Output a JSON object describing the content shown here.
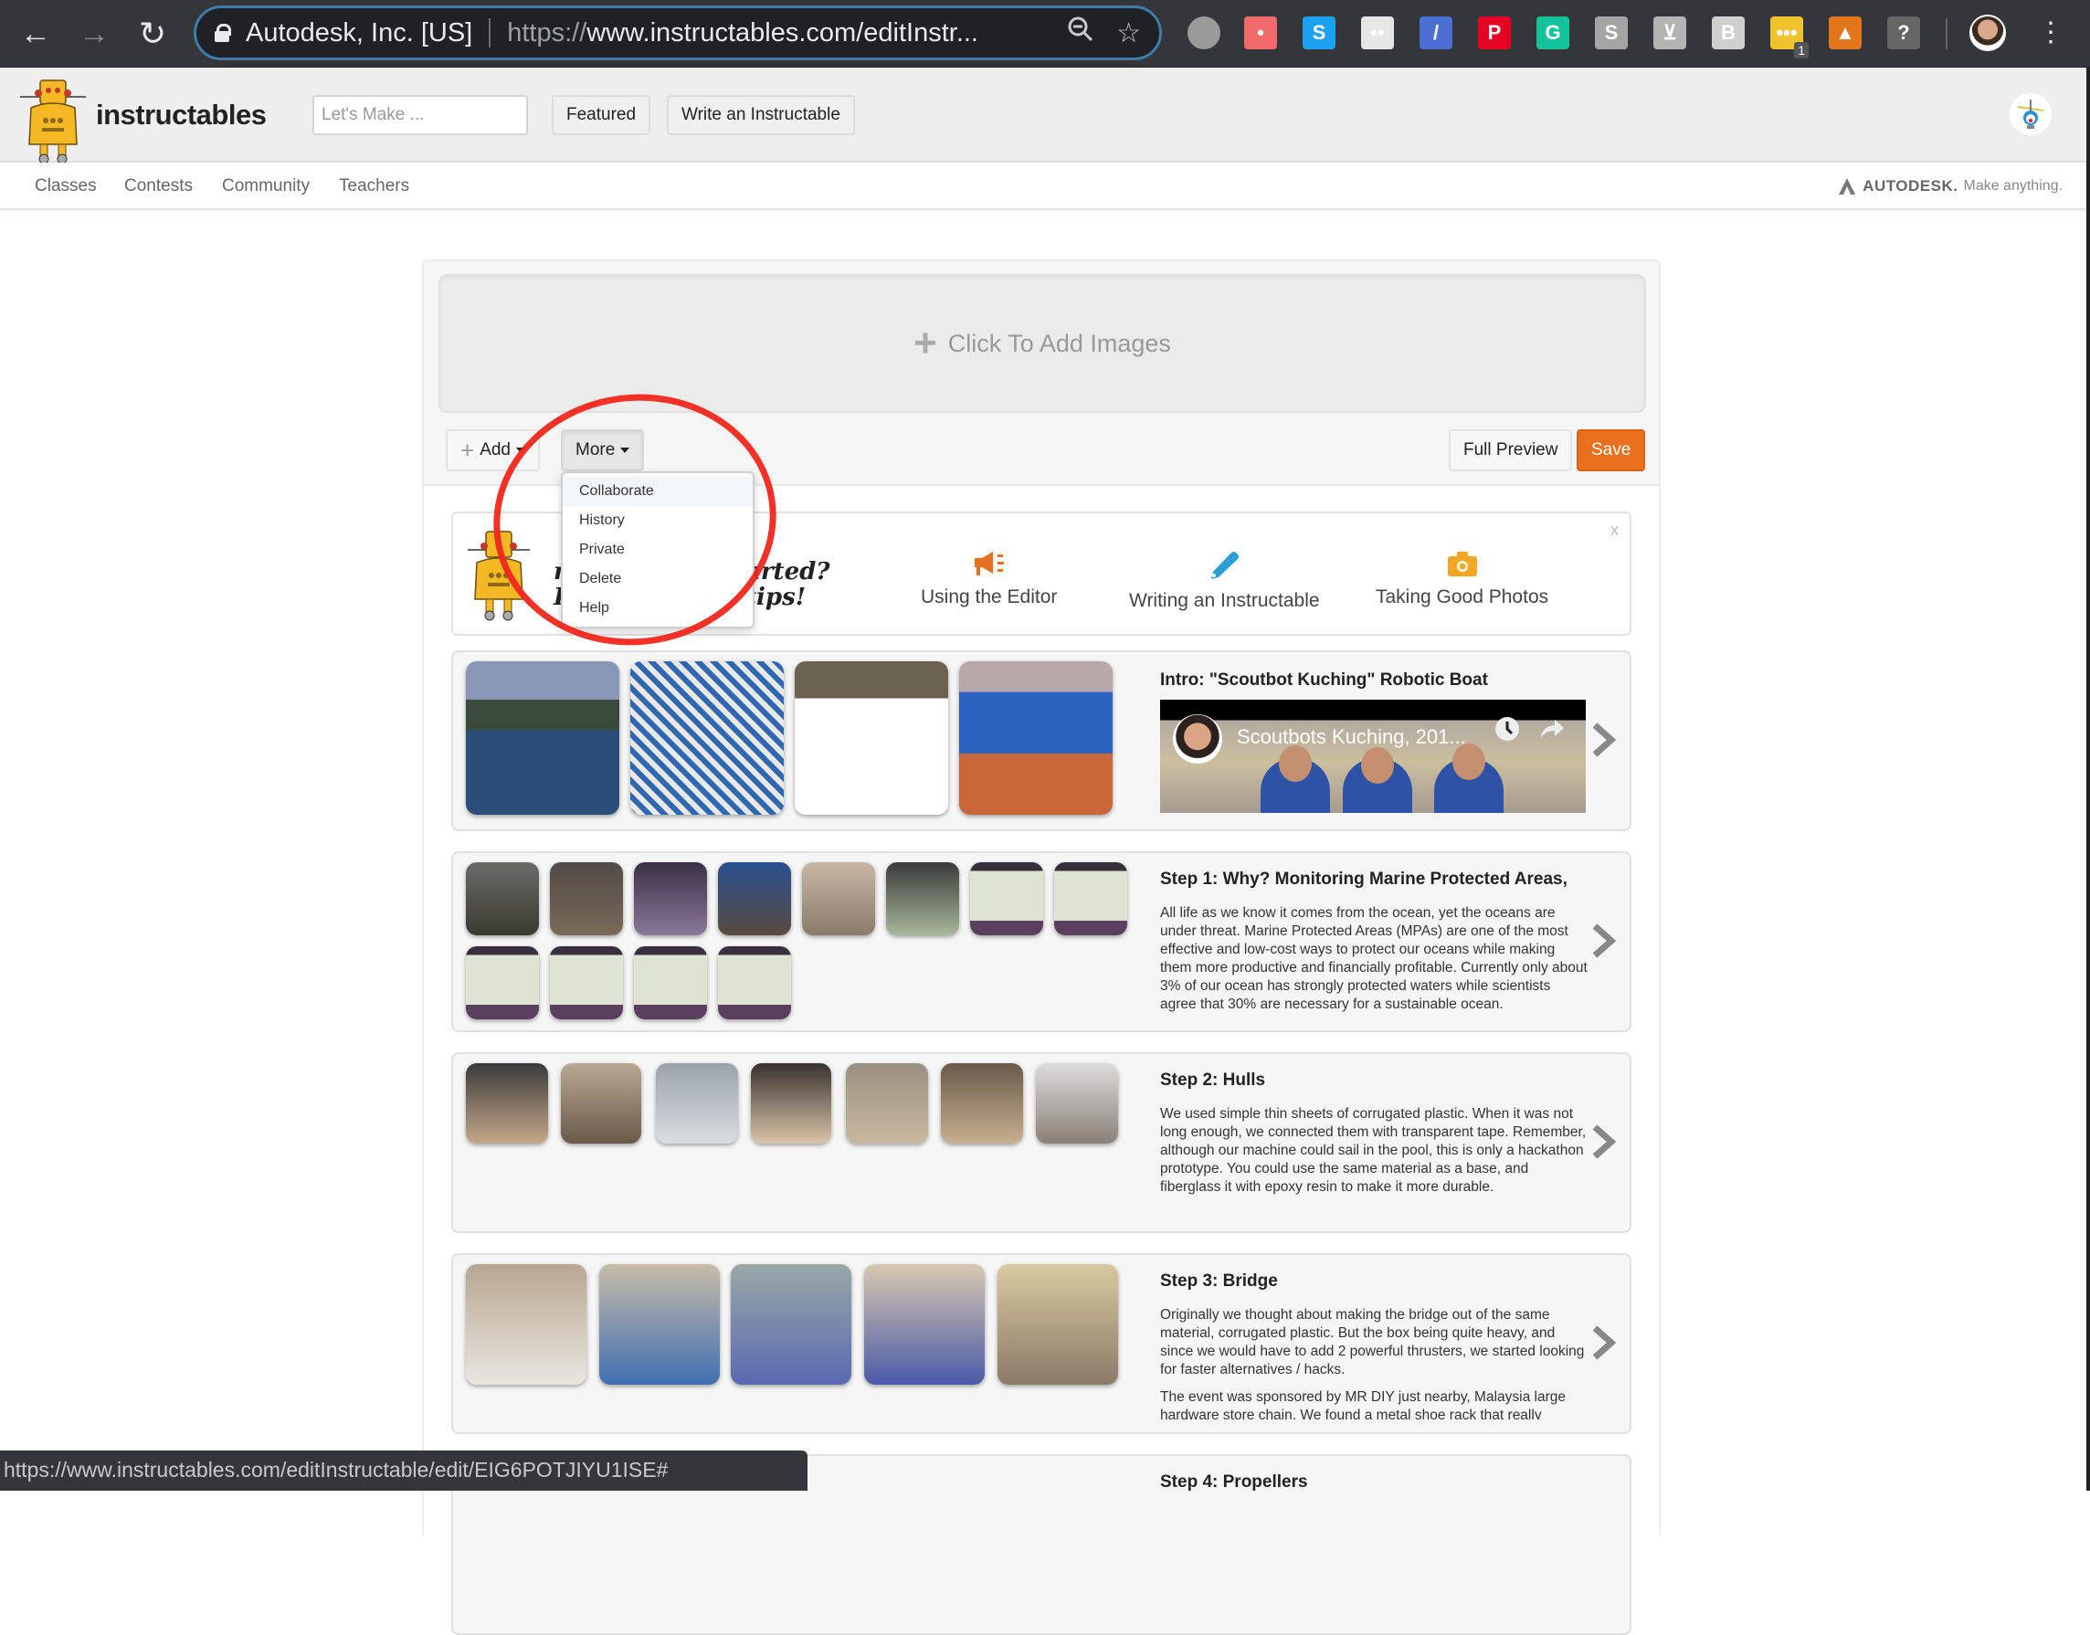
{
  "browser": {
    "org_label": "Autodesk, Inc. [US]",
    "url_scheme": "https://",
    "url_rest": "www.instructables.com/editInstr...",
    "extensions": [
      {
        "name": "speech-bubble-extension",
        "glyph": "",
        "color": "#9a9a9a"
      },
      {
        "name": "asana-extension",
        "glyph": "•",
        "color": "#f06a6a"
      },
      {
        "name": "skype-extension",
        "glyph": "S",
        "color": "#1da1f2"
      },
      {
        "name": "flickr-extension",
        "glyph": "••",
        "color": "#e6e6e6"
      },
      {
        "name": "eyedropper-extension",
        "glyph": "/",
        "color": "#4a6fd1"
      },
      {
        "name": "pinterest-extension",
        "glyph": "P",
        "color": "#e60023"
      },
      {
        "name": "grammarly-extension",
        "glyph": "G",
        "color": "#15c39a"
      },
      {
        "name": "skype-grey-extension",
        "glyph": "S",
        "color": "#a5a5a5"
      },
      {
        "name": "download-extension",
        "glyph": "⊻",
        "color": "#b3b3b3"
      },
      {
        "name": "bitly-extension",
        "glyph": "B",
        "color": "#cfcfcf"
      },
      {
        "name": "yellow-notes-extension",
        "glyph": "•••",
        "color": "#f0c22c",
        "badge": "1"
      },
      {
        "name": "metamask-extension",
        "glyph": "▲",
        "color": "#e2761b"
      },
      {
        "name": "lightbulb-extension",
        "glyph": "?",
        "color": "#666666"
      }
    ],
    "status_url": "https://www.instructables.com/editInstructable/edit/EIG6POTJIYU1ISE#"
  },
  "site": {
    "brand": "instructables",
    "search_placeholder": "Let's Make ...",
    "featured_label": "Featured",
    "write_label": "Write an Instructable",
    "nav": [
      "Classes",
      "Contests",
      "Community",
      "Teachers"
    ],
    "autodesk_word": "AUTODESK.",
    "autodesk_tag": "Make anything."
  },
  "editor": {
    "dropzone_label": "Click To Add Images",
    "add_label": "Add",
    "more_label": "More",
    "full_preview_label": "Full Preview",
    "save_label": "Save",
    "more_menu": [
      "Collaborate",
      "History",
      "Private",
      "Delete",
      "Help"
    ],
    "tips": {
      "hand_line1": "Need help getting started?",
      "hand_line2": "Here are some tips!",
      "hand_visible_1": "n",
      "hand_visible_2": "tarted?",
      "hand_visible_3": "H",
      "hand_visible_4": "tips!",
      "items": [
        {
          "label": "Using the Editor",
          "icon": "megaphone-icon",
          "color": "#e8701f"
        },
        {
          "label": "Writing an Instructable",
          "icon": "pencil-icon",
          "color": "#2a9fd6"
        },
        {
          "label": "Taking Good Photos",
          "icon": "camera-icon",
          "color": "#f5a623"
        }
      ],
      "close_label": "x"
    },
    "steps": [
      {
        "title": "Intro: \"Scoutbot Kuching\" Robotic Boat",
        "video_title": "Scoutbots Kuching, 201...",
        "text": []
      },
      {
        "title": "Step 1: Why? Monitoring Marine Protected Areas,",
        "text": [
          "All life as we know it comes from the ocean, yet the oceans are under threat. Marine Protected Areas (MPAs) are one of the most effective and low-cost ways to protect our oceans while making them more productive and financially profitable. Currently only about 3% of our ocean has strongly protected waters while scientists agree that 30% are necessary for a sustainable ocean."
        ]
      },
      {
        "title": "Step 2: Hulls",
        "text": [
          "We used simple thin sheets of corrugated plastic. When it was not long enough, we connected them with transparent tape. Remember, although our machine could sail in the pool, this is only a hackathon prototype. You could use the same material as a base, and fiberglass it with epoxy resin to make it more durable."
        ]
      },
      {
        "title": "Step 3: Bridge",
        "text": [
          "Originally we thought about making the bridge out of the same material, corrugated plastic. But the box being quite heavy, and since we would have to add 2 powerful thrusters, we started looking for faster alternatives / hacks.",
          "The event was sponsored by MR DIY just nearby, Malaysia large hardware store chain. We found a metal shoe rack that really"
        ]
      },
      {
        "title": "Step 4: Propellers",
        "text": []
      }
    ]
  }
}
